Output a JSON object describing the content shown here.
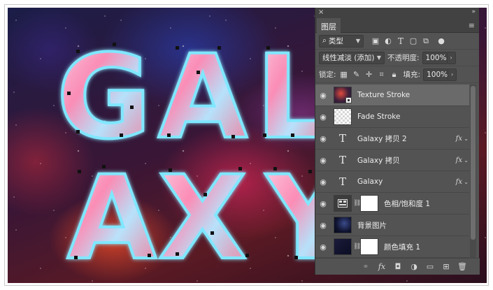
{
  "canvas": {
    "letters_row1": [
      "G",
      "A",
      "L"
    ],
    "letters_row2": [
      "A",
      "X",
      "Y"
    ],
    "glow_colors": {
      "outline": "#7fe7ff",
      "fill_pink": "#ff9fc8",
      "fill_blue": "#9fd8ff"
    }
  },
  "panel": {
    "close_glyph": "×",
    "collapse_glyph": "»",
    "tab_label": "图层",
    "menu_glyph": "≡",
    "filter": {
      "label": "类型",
      "icon": "search-icon"
    },
    "filter_icons": [
      "image-filter-icon",
      "adjustment-filter-icon",
      "type-filter-icon",
      "shape-filter-icon",
      "smart-object-filter-icon"
    ],
    "blend_mode": "线性减淡 (添加)",
    "opacity_label": "不透明度:",
    "opacity_value": "100%",
    "lock_label": "锁定:",
    "fill_label": "填充:",
    "fill_value": "100%",
    "layers": [
      {
        "name": "Texture Stroke",
        "kind": "smart",
        "thumb": "galaxy",
        "selected": true,
        "fx": false
      },
      {
        "name": "Fade Stroke",
        "kind": "pixel",
        "thumb": "checker",
        "selected": false,
        "fx": false
      },
      {
        "name": "Galaxy 拷贝 2",
        "kind": "type",
        "selected": false,
        "fx": true
      },
      {
        "name": "Galaxy 拷贝",
        "kind": "type",
        "selected": false,
        "fx": true
      },
      {
        "name": "Galaxy",
        "kind": "type",
        "selected": false,
        "fx": true
      },
      {
        "name": "色相/饱和度 1",
        "kind": "adjustment",
        "selected": false,
        "fx": false
      },
      {
        "name": "背景图片",
        "kind": "pixel",
        "thumb": "nightsky",
        "selected": false,
        "fx": false
      },
      {
        "name": "颜色填充 1",
        "kind": "fill",
        "selected": false,
        "fx": false
      },
      {
        "name": "",
        "kind": "pixel",
        "thumb": "black",
        "selected": false,
        "fx": false
      }
    ],
    "fx_label": "fx",
    "bottom_icons": [
      "link-icon",
      "fx-icon",
      "add-mask-icon",
      "new-adjustment-icon",
      "new-group-icon",
      "new-layer-icon",
      "trash-icon"
    ]
  }
}
